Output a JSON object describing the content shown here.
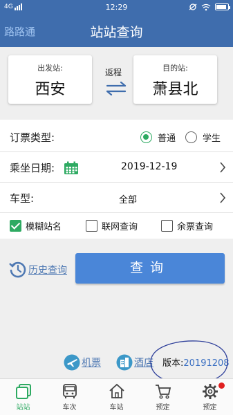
{
  "status_bar": {
    "network": "4G",
    "time": "12:29"
  },
  "header": {
    "brand": "路路通",
    "title": "站站查询"
  },
  "stations": {
    "from_label": "出发站:",
    "from_name": "西安",
    "return_label": "返程",
    "to_label": "目的站:",
    "to_name": "萧县北"
  },
  "form": {
    "ticket_type_label": "订票类型:",
    "ticket_options": [
      {
        "label": "普通",
        "selected": true
      },
      {
        "label": "学生",
        "selected": false
      }
    ],
    "date_label": "乘坐日期:",
    "date_value": "2019-12-19",
    "train_type_label": "车型:",
    "train_type_value": "全部",
    "checkboxes": [
      {
        "label": "模糊站名",
        "checked": true
      },
      {
        "label": "联网查询",
        "checked": false
      },
      {
        "label": "余票查询",
        "checked": false
      }
    ]
  },
  "actions": {
    "history_label": "历史查询",
    "query_label": "查询"
  },
  "links": {
    "air_ticket": "机票",
    "hotel": "酒店"
  },
  "version": {
    "label": "版本:",
    "value": "20191208"
  },
  "tabs": [
    {
      "label": "站站",
      "icon": "station-to-station-icon",
      "active": true
    },
    {
      "label": "车次",
      "icon": "bus-icon",
      "active": false
    },
    {
      "label": "车站",
      "icon": "house-icon",
      "active": false
    },
    {
      "label": "预定",
      "icon": "cart-icon",
      "active": false
    },
    {
      "label": "预定",
      "icon": "gear-icon",
      "active": false,
      "badge": true
    }
  ],
  "colors": {
    "primary": "#3f6dad",
    "accent_green": "#2eaa62",
    "button_blue": "#4a86d8",
    "link_blue": "#4f79b3"
  }
}
